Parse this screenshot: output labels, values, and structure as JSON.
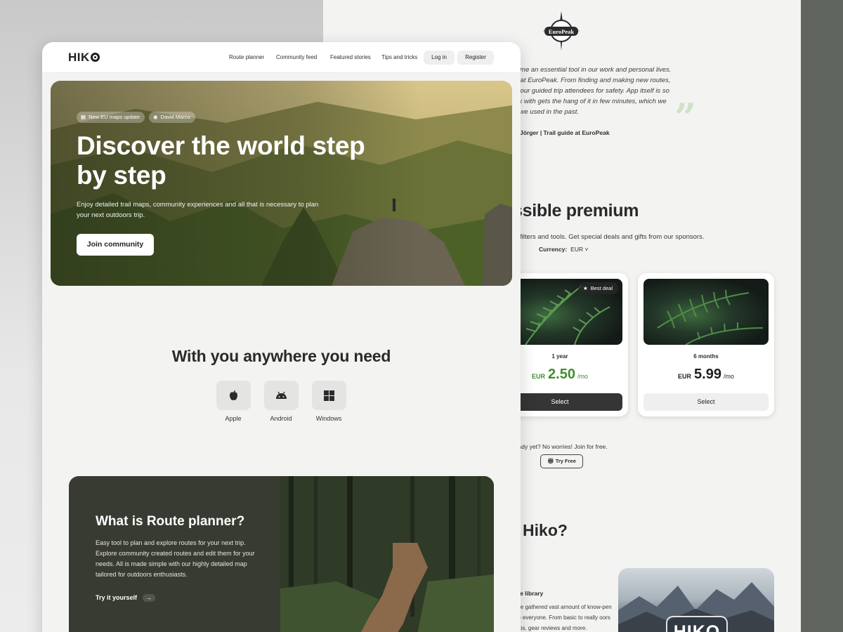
{
  "back_page": {
    "logo_text": "EuroPeak",
    "testimonial": {
      "lines": [
        "come an essential tool in our work and personal lives.",
        "m at EuroPeak. From finding and making new routes,",
        "of our guided trip attendees for safety. App itself is so",
        "ork with gets the hang of it in few minutes, which we",
        "ls we used in the past."
      ],
      "author": "Jörger | Trail guide at EuroPeak",
      "quote_mark": "”"
    },
    "premium": {
      "title": "ssible premium",
      "subtitle": "al filters and tools. Get special deals and gifts from our sponsors.",
      "currency_label": "Currency:",
      "currency_value": "EUR ˅",
      "plans": [
        {
          "badge": "Best deal",
          "term": "1 year",
          "currency": "EUR",
          "amount": "2.50",
          "per": "/mo",
          "select": "Select"
        },
        {
          "term": "6 months",
          "currency": "EUR",
          "amount": "5.99",
          "per": "/mo",
          "select": "Select"
        }
      ],
      "not_ready": "ready yet? No worries! Join for free.",
      "try_free": "Try Free"
    },
    "about": {
      "title": "t Hiko?",
      "knowledge_title": "ge library",
      "knowledge_text": "we gathered vast amount of know-pen to everyone. From basic to really oors tips, gear reviews and more.",
      "image_sign": "HIKO"
    }
  },
  "front_page": {
    "nav": {
      "logo": "HIK",
      "links": [
        "Route planner",
        "Community feed",
        "Featured stories",
        "Tips and tricks"
      ],
      "login": "Log in",
      "register": "Register"
    },
    "hero": {
      "chips": [
        "New EU maps update",
        "David Marcu"
      ],
      "title": "Discover the world step by step",
      "text": "Enjoy detailed trail maps, community experiences and all that is necessary to plan your next outdoors trip.",
      "cta": "Join community"
    },
    "anywhere": {
      "title": "With you anywhere you need",
      "platforms": [
        "Apple",
        "Android",
        "Windows"
      ]
    },
    "route_planner": {
      "title": "What is Route planner?",
      "text": "Easy tool to plan and explore routes for your next trip. Explore community created routes and edit them for your needs. All is made simple with our highly detailed map tailored for outdoors enthusiasts.",
      "cta": "Try it yourself",
      "cta_arrow": "→"
    }
  },
  "colors": {
    "accent_green": "#3f8f2f",
    "dark_panel": "#383b32",
    "page_bg": "#f3f3f2",
    "outer_bg": "#5d615b"
  }
}
